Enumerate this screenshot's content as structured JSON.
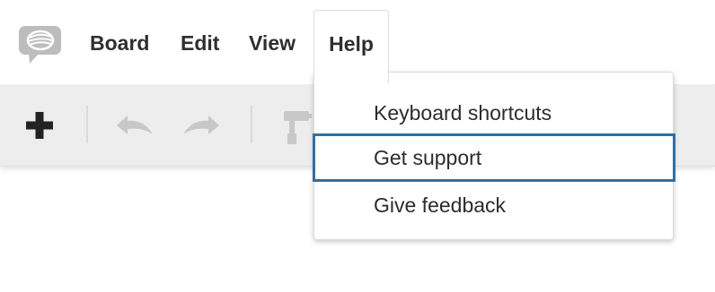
{
  "menubar": {
    "logo_icon": "speech-bubble-logo-icon",
    "items": [
      {
        "label": "Board"
      },
      {
        "label": "Edit"
      },
      {
        "label": "View"
      },
      {
        "label": "Help"
      }
    ]
  },
  "toolbar": {
    "tools": [
      {
        "icon": "plus-icon",
        "state": "enabled"
      },
      {
        "icon": "undo-icon",
        "state": "disabled"
      },
      {
        "icon": "redo-icon",
        "state": "disabled"
      },
      {
        "icon": "paint-roller-icon",
        "state": "disabled"
      }
    ]
  },
  "help_menu": {
    "items": [
      {
        "label": "Keyboard shortcuts"
      },
      {
        "label": "Get support",
        "focused": true
      },
      {
        "label": "Give feedback"
      }
    ]
  },
  "colors": {
    "focus_outline": "#2f6fa6",
    "toolbar_bg": "#ededed",
    "icon_enabled": "#222222",
    "icon_disabled": "#c8c8c8",
    "logo": "#bdbdbd"
  }
}
